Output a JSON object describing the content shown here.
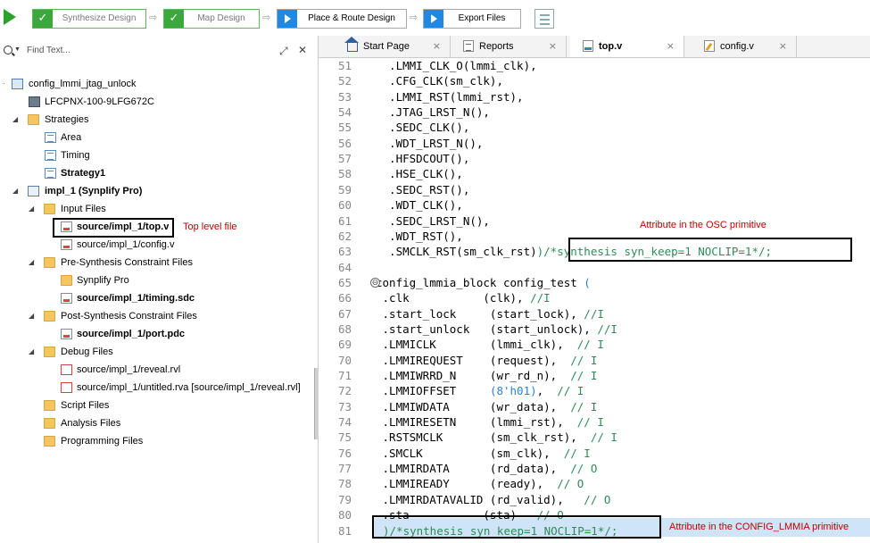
{
  "toolbar": {
    "steps": [
      {
        "label": "Synthesize Design",
        "state": "done"
      },
      {
        "label": "Map Design",
        "state": "done"
      },
      {
        "label": "Place & Route Design",
        "state": "pending"
      },
      {
        "label": "Export Files",
        "state": "pending"
      }
    ],
    "arrow": "⇨"
  },
  "left_panel": {
    "search_placeholder": "Find Text...",
    "tree": [
      {
        "label": "config_lmmi_jtag_unlock",
        "bold": false
      },
      {
        "label": "LFCPNX-100-9LFG672C",
        "bold": false
      },
      {
        "label": "Strategies",
        "bold": false
      },
      {
        "label": "Area",
        "bold": false
      },
      {
        "label": "Timing",
        "bold": false
      },
      {
        "label": "Strategy1",
        "bold": true
      },
      {
        "label": "impl_1 (Synplify Pro)",
        "bold": true
      },
      {
        "label": "Input Files",
        "bold": false
      },
      {
        "label": "source/impl_1/top.v",
        "bold": true
      },
      {
        "label": "source/impl_1/config.v",
        "bold": false
      },
      {
        "label": "Pre-Synthesis Constraint Files",
        "bold": false
      },
      {
        "label": "Synplify Pro",
        "bold": false
      },
      {
        "label": "source/impl_1/timing.sdc",
        "bold": true
      },
      {
        "label": "Post-Synthesis Constraint Files",
        "bold": false
      },
      {
        "label": "source/impl_1/port.pdc",
        "bold": true
      },
      {
        "label": "Debug Files",
        "bold": false
      },
      {
        "label": "source/impl_1/reveal.rvl",
        "bold": false
      },
      {
        "label": "source/impl_1/untitled.rva [source/impl_1/reveal.rvl]",
        "bold": false
      },
      {
        "label": "Script Files",
        "bold": false
      },
      {
        "label": "Analysis Files",
        "bold": false
      },
      {
        "label": "Programming Files",
        "bold": false
      }
    ],
    "annotation_top_level": "Top level file"
  },
  "tabs": [
    {
      "label": "Start Page",
      "active": false
    },
    {
      "label": "Reports",
      "active": false
    },
    {
      "label": "top.v",
      "active": true
    },
    {
      "label": "config.v",
      "active": false
    }
  ],
  "tab_close": "×",
  "editor": {
    "lines": [
      {
        "n": "51",
        "code": "  .LMMI_CLK_O(lmmi_clk),"
      },
      {
        "n": "52",
        "code": "  .CFG_CLK(sm_clk),"
      },
      {
        "n": "53",
        "code": "  .LMMI_RST(lmmi_rst),"
      },
      {
        "n": "54",
        "code": "  .JTAG_LRST_N(),"
      },
      {
        "n": "55",
        "code": "  .SEDC_CLK(),"
      },
      {
        "n": "56",
        "code": "  .WDT_LRST_N(),"
      },
      {
        "n": "57",
        "code": "  .HFSDCOUT(),"
      },
      {
        "n": "58",
        "code": "  .HSE_CLK(),"
      },
      {
        "n": "59",
        "code": "  .SEDC_RST(),"
      },
      {
        "n": "60",
        "code": "  .WDT_CLK(),"
      },
      {
        "n": "61",
        "code": "  .SEDC_LRST_N(),"
      },
      {
        "n": "62",
        "code": "  .WDT_RST(),"
      },
      {
        "n": "63",
        "code": "  .SMCLK_RST(sm_clk_rst)",
        "comment": ")/*synthesis syn_keep=1 NOCLIP=1*/;"
      },
      {
        "n": "64",
        "code": ""
      },
      {
        "n": "65",
        "code": "config_lmmia_block config_test ",
        "paren": "("
      },
      {
        "n": "66",
        "code": " .clk           (clk), ",
        "comment": "//I"
      },
      {
        "n": "67",
        "code": " .start_lock     (start_lock), ",
        "comment": "//I"
      },
      {
        "n": "68",
        "code": " .start_unlock   (start_unlock), ",
        "comment": "//I"
      },
      {
        "n": "69",
        "code": " .LMMICLK        (lmmi_clk),  ",
        "comment": "// I"
      },
      {
        "n": "70",
        "code": " .LMMIREQUEST    (request),  ",
        "comment": "// I"
      },
      {
        "n": "71",
        "code": " .LMMIWRRD_N     (wr_rd_n),  ",
        "comment": "// I"
      },
      {
        "n": "72",
        "code": " .LMMIOFFSET     ",
        "paren2": "(8'h01)",
        "tail": ",  ",
        "comment": "// I"
      },
      {
        "n": "73",
        "code": " .LMMIWDATA      (wr_data),  ",
        "comment": "// I"
      },
      {
        "n": "74",
        "code": " .LMMIRESETN     (lmmi_rst),  ",
        "comment": "// I"
      },
      {
        "n": "75",
        "code": " .RSTSMCLK       (sm_clk_rst),  ",
        "comment": "// I"
      },
      {
        "n": "76",
        "code": " .SMCLK          (sm_clk),  ",
        "comment": "// I"
      },
      {
        "n": "77",
        "code": " .LMMIRDATA      (rd_data),  ",
        "comment": "// O"
      },
      {
        "n": "78",
        "code": " .LMMIREADY      (ready),  ",
        "comment": "// O"
      },
      {
        "n": "79",
        "code": " .LMMIRDATAVALID (rd_valid),   ",
        "comment": "// O"
      },
      {
        "n": "80",
        "code": " .sta           (sta)   ",
        "comment": "// O"
      },
      {
        "n": "81",
        "code": "",
        "comment": ")/*synthesis syn_keep=1 NOCLIP=1*/;"
      }
    ],
    "annotation_osc": "Attribute in the OSC primitive",
    "annotation_cfg": "Attribute in the CONFIG_LMMIA primitive",
    "fold_symbol": "⊖"
  },
  "colors": {
    "comment": "#2e8b57",
    "annotation": "#c00000",
    "accent": "#1e88e5",
    "done": "#3aa83a"
  }
}
